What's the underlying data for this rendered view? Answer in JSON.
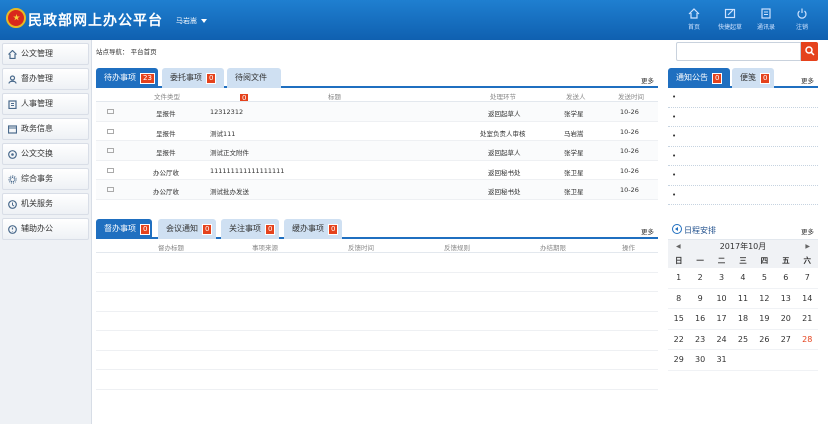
{
  "header": {
    "title": "民政部网上办公平台",
    "user": "马岩嵩",
    "buttons": [
      {
        "label": "首页",
        "icon": "home-icon"
      },
      {
        "label": "快捷起草",
        "icon": "edit-icon"
      },
      {
        "label": "通讯录",
        "icon": "contacts-icon"
      },
      {
        "label": "注销",
        "icon": "power-icon"
      }
    ]
  },
  "sidebar": {
    "items": [
      {
        "label": "公文管理",
        "icon": "home-icon"
      },
      {
        "label": "督办管理",
        "icon": "user-icon"
      },
      {
        "label": "人事管理",
        "icon": "clipboard-icon"
      },
      {
        "label": "政务信息",
        "icon": "window-icon"
      },
      {
        "label": "公文交换",
        "icon": "exchange-icon"
      },
      {
        "label": "综合事务",
        "icon": "gear-icon"
      },
      {
        "label": "机关服务",
        "icon": "service-icon"
      },
      {
        "label": "辅助办公",
        "icon": "assist-icon"
      }
    ]
  },
  "breadcrumb": "站点导航：  平台首页",
  "search": {
    "placeholder": ""
  },
  "todo": {
    "tabs": [
      {
        "label": "待办事项",
        "count": "23"
      },
      {
        "label": "委托事项",
        "count": "0"
      },
      {
        "label": "待阅文件",
        "count": "0"
      }
    ],
    "more": "更多",
    "headers": [
      "文件类型",
      "标题",
      "处理环节",
      "发送人",
      "发送时间"
    ],
    "rows": [
      [
        "呈报件",
        "12312312",
        "返回起草人",
        "张学星",
        "10-26"
      ],
      [
        "呈报件",
        "测试111",
        "处室负责人审核",
        "马岩嵩",
        "10-26"
      ],
      [
        "呈报件",
        "测试正文附件",
        "返回起草人",
        "张学星",
        "10-26"
      ],
      [
        "办公厅收",
        "111111111111111111",
        "返回秘书处",
        "张卫星",
        "10-26"
      ],
      [
        "办公厅收",
        "测试批办发送",
        "返回秘书处",
        "张卫星",
        "10-26"
      ]
    ]
  },
  "supervise": {
    "tabs": [
      {
        "label": "督办事项",
        "count": "0"
      },
      {
        "label": "会议通知",
        "count": "0"
      },
      {
        "label": "关注事项",
        "count": "0"
      },
      {
        "label": "缓办事项",
        "count": "0"
      }
    ],
    "more": "更多",
    "headers": [
      "督办标题",
      "事项来源",
      "反馈时间",
      "反馈规则",
      "办结期限",
      "操作"
    ]
  },
  "notice": {
    "tabs": [
      {
        "label": "通知公告",
        "count": "0"
      },
      {
        "label": "便笺",
        "count": "0"
      }
    ],
    "more": "更多",
    "bullet": "•"
  },
  "calendar": {
    "title": "日程安排",
    "more": "更多",
    "month": "2017年10月",
    "prev": "◀",
    "next": "▶",
    "weekdays": [
      "日",
      "一",
      "二",
      "三",
      "四",
      "五",
      "六"
    ],
    "days": [
      "1",
      "2",
      "3",
      "4",
      "5",
      "6",
      "7",
      "8",
      "9",
      "10",
      "11",
      "12",
      "13",
      "14",
      "15",
      "16",
      "17",
      "18",
      "19",
      "20",
      "21",
      "22",
      "23",
      "24",
      "25",
      "26",
      "27",
      "28",
      "29",
      "30",
      "31"
    ],
    "highlight_day": "28",
    "highlight_color": "#e5421c"
  },
  "colors": {
    "header": "#1565b8",
    "accent": "#1f6fc0",
    "badge": "#e5421c"
  }
}
